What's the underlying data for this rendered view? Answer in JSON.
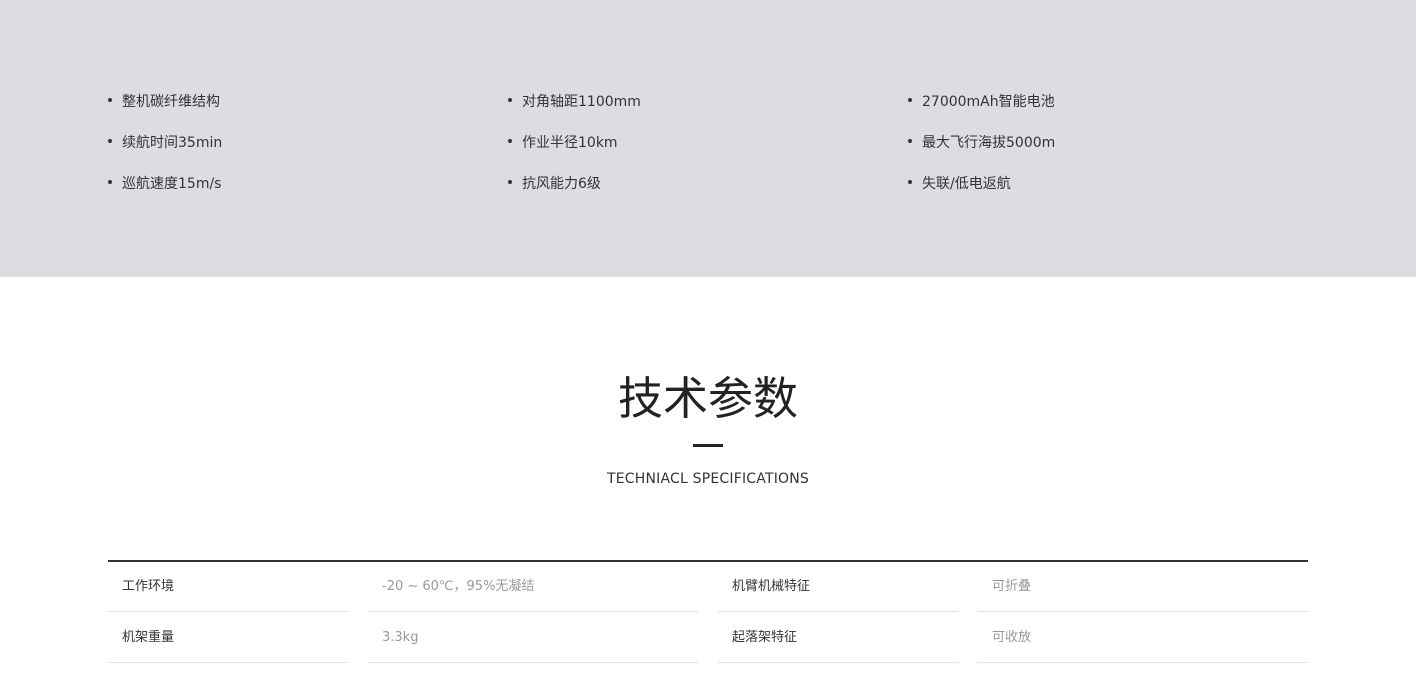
{
  "features": {
    "col0": [
      "整机碳纤维结构",
      "续航时间35min",
      "巡航速度15m/s"
    ],
    "col1": [
      "对角轴距1100mm",
      "作业半径10km",
      "抗风能力6级"
    ],
    "col2": [
      "27000mAh智能电池",
      "最大飞行海拔5000m",
      "失联/低电返航"
    ]
  },
  "specs": {
    "title": "技术参数",
    "subtitle": "TECHNIACL SPECIFICATIONS",
    "rows": [
      {
        "label1": "工作环境",
        "value1": "-20 ~ 60℃，95%无凝结",
        "label2": "机臂机械特征",
        "value2": "可折叠"
      },
      {
        "label1": "机架重量",
        "value1": "3.3kg",
        "label2": "起落架特征",
        "value2": "可收放"
      }
    ]
  }
}
